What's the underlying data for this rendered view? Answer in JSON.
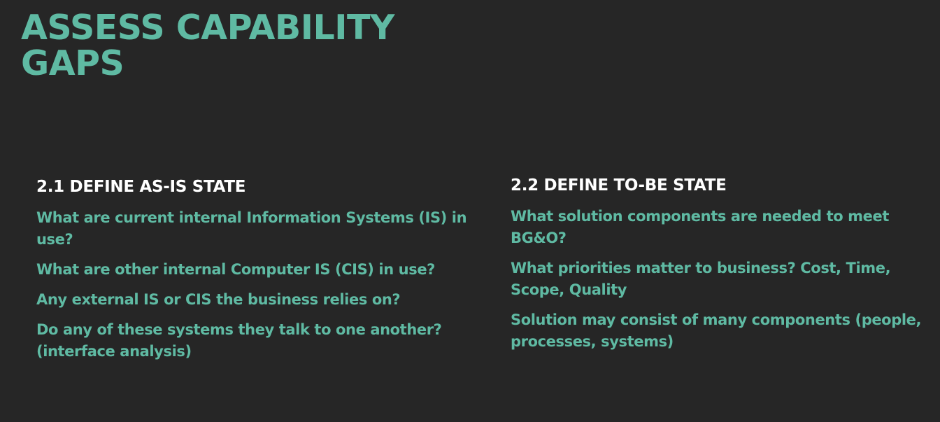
{
  "slide": {
    "title_lines": [
      "ASSESS CAPABILITY",
      "GAPS"
    ],
    "left": {
      "heading": "2.1 DEFINE AS-IS STATE",
      "items": [
        "What are current internal Information Systems (IS) in use?",
        "What are other internal Computer IS (CIS) in use?",
        "Any external IS or CIS the business relies on?",
        "Do any of these systems they talk to one another? (interface analysis)"
      ]
    },
    "right": {
      "heading": "2.2 DEFINE TO-BE STATE",
      "items": [
        "What solution components are needed to meet BG&O?",
        "What priorities matter to business? Cost, Time, Scope, Quality",
        "Solution may consist of many components (people, processes, systems)"
      ]
    }
  },
  "colors": {
    "background": "#262626",
    "accent": "#5fbaa3",
    "heading": "#ffffff"
  }
}
